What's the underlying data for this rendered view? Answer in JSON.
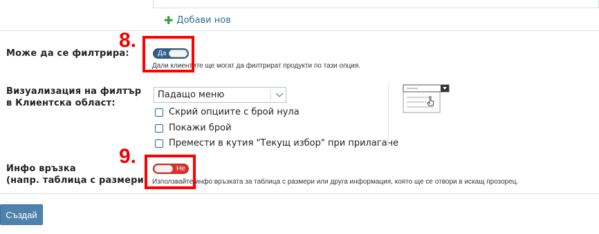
{
  "add_new": {
    "label": "Добави нов",
    "icon": "plus-icon"
  },
  "filterable": {
    "label": "Може да се филтрира:",
    "toggle_text": "Да",
    "help": "Дали клиентите ще могат да филтрират продукти по тази опция."
  },
  "filter_visualization": {
    "label_line1": "Визуализация на филтър",
    "label_line2": "в Клиентска област:",
    "select_value": "Падащо меню",
    "checkboxes": [
      {
        "label": "Скрий опциите с брой нула",
        "checked": false
      },
      {
        "label": "Покажи брой",
        "checked": false
      },
      {
        "label": "Премести в кутия \"Текущ избор\" при прилагане",
        "checked": false
      }
    ]
  },
  "info_link": {
    "label_line1": "Инфо връзка",
    "label_line2": "(напр. таблица с размери)",
    "toggle_text": "Не",
    "help": "Използвайте инфо връзката за таблица с размери или друга информация, която ще се отвори в искащ прозорец."
  },
  "annotations": {
    "marker_8": "8.",
    "marker_9": "9."
  },
  "create_button": {
    "label": "Създай"
  },
  "colors": {
    "toggle_on": "#2f5e8c",
    "toggle_off": "#d9312d",
    "annotation_red": "#ff0000",
    "button": "#4e82ad",
    "link": "#2f6d9a"
  }
}
